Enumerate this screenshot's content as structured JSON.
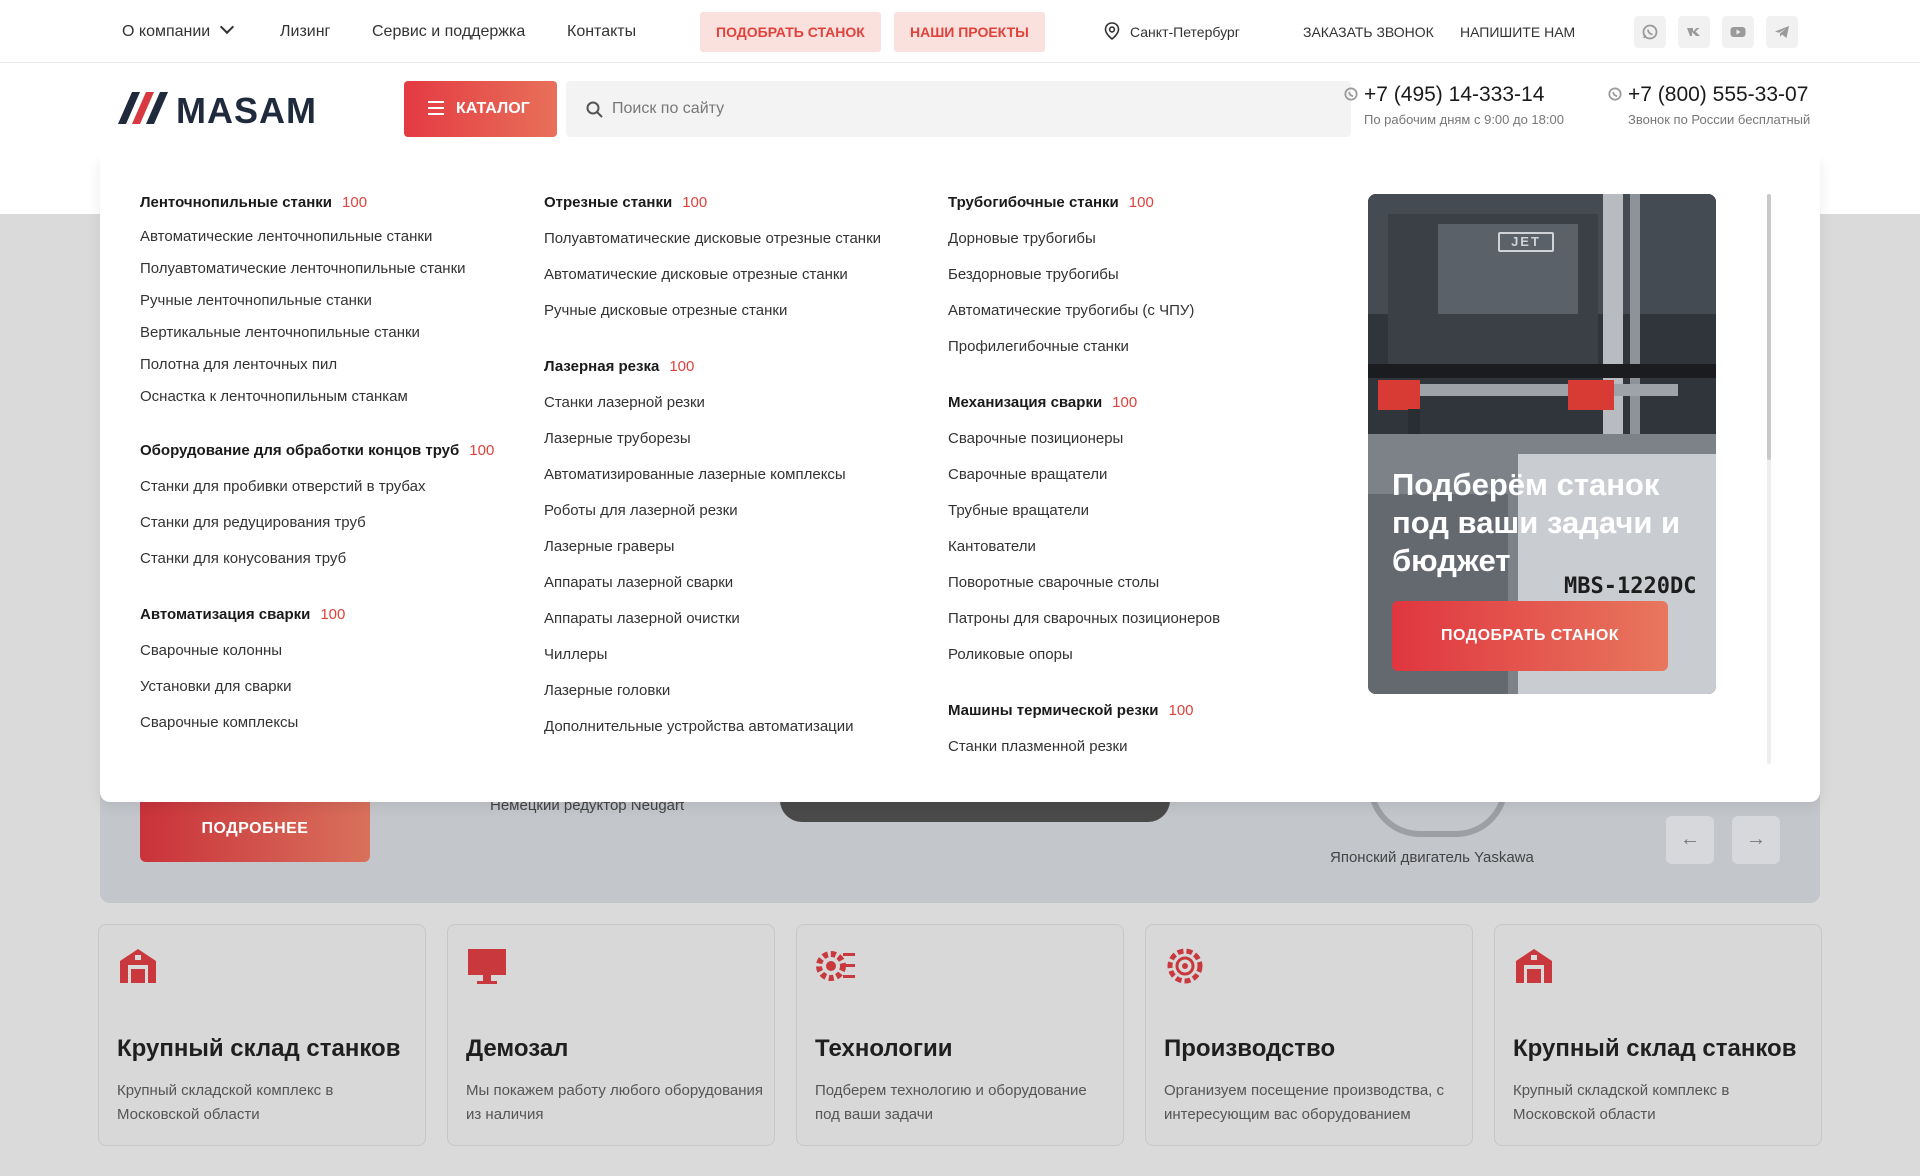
{
  "topbar": {
    "about": "О компании",
    "leasing": "Лизинг",
    "service": "Сервис и поддержка",
    "contacts": "Контакты",
    "pick_machine": "ПОДОБРАТЬ СТАНОК",
    "our_projects": "НАШИ ПРОЕКТЫ",
    "city": "Санкт-Петербург",
    "order_call": "ЗАКАЗАТЬ ЗВОНОК",
    "write_us": "НАПИШИТЕ НАМ",
    "social": [
      "whatsapp-icon",
      "vk-icon",
      "youtube-icon",
      "telegram-icon"
    ]
  },
  "header": {
    "logo": "MASAM",
    "catalog_label": "КАТАЛОГ",
    "search_placeholder": "Поиск по сайту",
    "phones": [
      {
        "number": "+7 (495) 14-333-14",
        "note": "По рабочим дням с 9:00 до 18:00"
      },
      {
        "number": "+7 (800) 555-33-07",
        "note": "Звонок по России бесплатный"
      }
    ]
  },
  "catalog": {
    "columns": [
      [
        {
          "title": "Ленточнопильные станки",
          "count": "100",
          "items": [
            "Автоматические ленточнопильные станки",
            "Полуавтоматические ленточнопильные станки",
            "Ручные ленточнопильные станки",
            "Вертикальные ленточнопильные станки",
            "Полотна для ленточных пил",
            "Оснастка к ленточнопильным станкам"
          ]
        },
        {
          "title": "Оборудование для обработки концов труб",
          "count": "100",
          "items": [
            "Станки для пробивки отверстий в трубах",
            "Станки для редуцирования труб",
            "Станки для конусования труб"
          ]
        },
        {
          "title": "Автоматизация сварки",
          "count": "100",
          "items": [
            "Сварочные колонны",
            "Установки для сварки",
            "Сварочные комплексы"
          ]
        }
      ],
      [
        {
          "title": "Отрезные станки",
          "count": "100",
          "items": [
            "Полуавтоматические дисковые отрезные станки",
            "Автоматические дисковые отрезные станки",
            "Ручные дисковые отрезные станки"
          ]
        },
        {
          "title": "Лазерная резка",
          "count": "100",
          "items": [
            "Станки лазерной резки",
            "Лазерные труборезы",
            "Автоматизированные лазерные комплексы",
            "Роботы для лазерной резки",
            "Лазерные граверы",
            "Аппараты лазерной сварки",
            "Аппараты лазерной очистки",
            "Чиллеры",
            "Лазерные головки",
            "Дополнительные устройства автоматизации"
          ]
        }
      ],
      [
        {
          "title": "Трубогибочные станки",
          "count": "100",
          "items": [
            "Дорновые трубогибы",
            "Бездорновые трубогибы",
            "Автоматические трубогибы (с ЧПУ)",
            "Профилегибочные станки"
          ]
        },
        {
          "title": "Механизация сварки",
          "count": "100",
          "items": [
            "Сварочные позиционеры",
            "Сварочные вращатели",
            "Трубные вращатели",
            "Кантователи",
            "Поворотные сварочные столы",
            "Патроны для сварочных позиционеров",
            "Роликовые опоры"
          ]
        },
        {
          "title": "Машины термической резки",
          "count": "100",
          "items": [
            "Станки плазменной резки"
          ]
        }
      ]
    ],
    "promo": {
      "title": "Подберём станок под ваши задачи и бюджет",
      "button": "ПОДОБРАТЬ СТАНОК",
      "brand": "JET",
      "model": "MBS-1220DC"
    }
  },
  "hero": {
    "more_button": "ПОДРОБНЕЕ",
    "caption_left": "Немецкий редуктор Neugart",
    "caption_right": "Японский двигатель Yaskawa"
  },
  "features": [
    {
      "icon": "warehouse-icon",
      "title": "Крупный склад станков",
      "text": "Крупный складской комплекс в Московской области"
    },
    {
      "icon": "monitor-icon",
      "title": "Демозал",
      "text": "Мы покажем работу любого оборудования из наличия"
    },
    {
      "icon": "gear-tech-icon",
      "title": "Технологии",
      "text": "Подберем технологию и оборудование под ваши задачи"
    },
    {
      "icon": "production-gear-icon",
      "title": "Производство",
      "text": "Организуем посещение производства, с интересующим вас оборудованием"
    },
    {
      "icon": "warehouse-icon",
      "title": "Крупный склад станков",
      "text": "Крупный складской комплекс в Московской области"
    }
  ],
  "colors": {
    "accent": "#e0423b",
    "pill_bg": "#fbe1de",
    "logo": "#1f2a3d",
    "overlay": "#dadada"
  }
}
